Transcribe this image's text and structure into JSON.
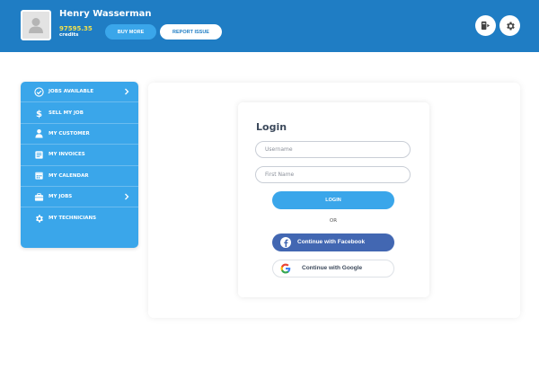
{
  "header": {
    "user_name": "Henry Wasserman",
    "credits_amount": "97595.35",
    "credits_label": "credits",
    "buy_more_label": "BUY MORE",
    "report_issue_label": "REPORT ISSUE",
    "icons": [
      "switch-account-icon",
      "settings-gear-icon"
    ]
  },
  "sidebar": {
    "items": [
      {
        "label": "JOBS AVAILABLE",
        "icon": "check-circle-icon",
        "has_chevron": true
      },
      {
        "label": "SELL MY JOB",
        "icon": "dollar-icon",
        "has_chevron": false
      },
      {
        "label": "MY CUSTOMER",
        "icon": "person-icon",
        "has_chevron": false
      },
      {
        "label": "MY INVOICES",
        "icon": "invoice-icon",
        "has_chevron": false
      },
      {
        "label": "MY CALENDAR",
        "icon": "calendar-icon",
        "has_chevron": false
      },
      {
        "label": "MY JOBS",
        "icon": "briefcase-icon",
        "has_chevron": true
      },
      {
        "label": "MY TECHNICIANS",
        "icon": "gear-icon",
        "has_chevron": false
      }
    ]
  },
  "login": {
    "title": "Login",
    "username_placeholder": "Username",
    "firstname_placeholder": "First Name",
    "login_label": "LOGIN",
    "or_label": "OR",
    "facebook_label": "Continue with Facebook",
    "google_label": "Continue with Google"
  },
  "colors": {
    "header_bg": "#1f7dc4",
    "accent": "#3aa6ea",
    "facebook": "#4267b2",
    "credits": "#f2e14c"
  }
}
